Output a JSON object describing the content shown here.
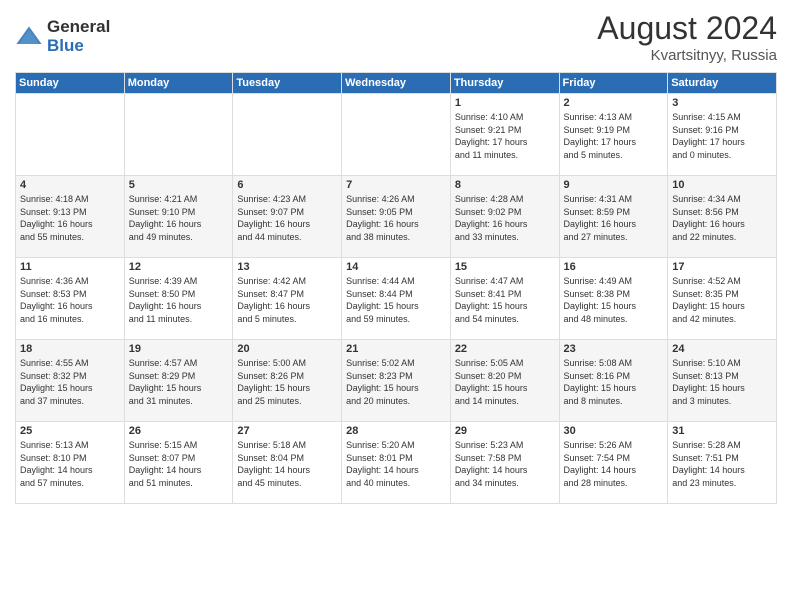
{
  "logo": {
    "general": "General",
    "blue": "Blue"
  },
  "title": {
    "month_year": "August 2024",
    "location": "Kvartsitnyy, Russia"
  },
  "days_of_week": [
    "Sunday",
    "Monday",
    "Tuesday",
    "Wednesday",
    "Thursday",
    "Friday",
    "Saturday"
  ],
  "weeks": [
    [
      {
        "day": "",
        "content": ""
      },
      {
        "day": "",
        "content": ""
      },
      {
        "day": "",
        "content": ""
      },
      {
        "day": "",
        "content": ""
      },
      {
        "day": "1",
        "content": "Sunrise: 4:10 AM\nSunset: 9:21 PM\nDaylight: 17 hours\nand 11 minutes."
      },
      {
        "day": "2",
        "content": "Sunrise: 4:13 AM\nSunset: 9:19 PM\nDaylight: 17 hours\nand 5 minutes."
      },
      {
        "day": "3",
        "content": "Sunrise: 4:15 AM\nSunset: 9:16 PM\nDaylight: 17 hours\nand 0 minutes."
      }
    ],
    [
      {
        "day": "4",
        "content": "Sunrise: 4:18 AM\nSunset: 9:13 PM\nDaylight: 16 hours\nand 55 minutes."
      },
      {
        "day": "5",
        "content": "Sunrise: 4:21 AM\nSunset: 9:10 PM\nDaylight: 16 hours\nand 49 minutes."
      },
      {
        "day": "6",
        "content": "Sunrise: 4:23 AM\nSunset: 9:07 PM\nDaylight: 16 hours\nand 44 minutes."
      },
      {
        "day": "7",
        "content": "Sunrise: 4:26 AM\nSunset: 9:05 PM\nDaylight: 16 hours\nand 38 minutes."
      },
      {
        "day": "8",
        "content": "Sunrise: 4:28 AM\nSunset: 9:02 PM\nDaylight: 16 hours\nand 33 minutes."
      },
      {
        "day": "9",
        "content": "Sunrise: 4:31 AM\nSunset: 8:59 PM\nDaylight: 16 hours\nand 27 minutes."
      },
      {
        "day": "10",
        "content": "Sunrise: 4:34 AM\nSunset: 8:56 PM\nDaylight: 16 hours\nand 22 minutes."
      }
    ],
    [
      {
        "day": "11",
        "content": "Sunrise: 4:36 AM\nSunset: 8:53 PM\nDaylight: 16 hours\nand 16 minutes."
      },
      {
        "day": "12",
        "content": "Sunrise: 4:39 AM\nSunset: 8:50 PM\nDaylight: 16 hours\nand 11 minutes."
      },
      {
        "day": "13",
        "content": "Sunrise: 4:42 AM\nSunset: 8:47 PM\nDaylight: 16 hours\nand 5 minutes."
      },
      {
        "day": "14",
        "content": "Sunrise: 4:44 AM\nSunset: 8:44 PM\nDaylight: 15 hours\nand 59 minutes."
      },
      {
        "day": "15",
        "content": "Sunrise: 4:47 AM\nSunset: 8:41 PM\nDaylight: 15 hours\nand 54 minutes."
      },
      {
        "day": "16",
        "content": "Sunrise: 4:49 AM\nSunset: 8:38 PM\nDaylight: 15 hours\nand 48 minutes."
      },
      {
        "day": "17",
        "content": "Sunrise: 4:52 AM\nSunset: 8:35 PM\nDaylight: 15 hours\nand 42 minutes."
      }
    ],
    [
      {
        "day": "18",
        "content": "Sunrise: 4:55 AM\nSunset: 8:32 PM\nDaylight: 15 hours\nand 37 minutes."
      },
      {
        "day": "19",
        "content": "Sunrise: 4:57 AM\nSunset: 8:29 PM\nDaylight: 15 hours\nand 31 minutes."
      },
      {
        "day": "20",
        "content": "Sunrise: 5:00 AM\nSunset: 8:26 PM\nDaylight: 15 hours\nand 25 minutes."
      },
      {
        "day": "21",
        "content": "Sunrise: 5:02 AM\nSunset: 8:23 PM\nDaylight: 15 hours\nand 20 minutes."
      },
      {
        "day": "22",
        "content": "Sunrise: 5:05 AM\nSunset: 8:20 PM\nDaylight: 15 hours\nand 14 minutes."
      },
      {
        "day": "23",
        "content": "Sunrise: 5:08 AM\nSunset: 8:16 PM\nDaylight: 15 hours\nand 8 minutes."
      },
      {
        "day": "24",
        "content": "Sunrise: 5:10 AM\nSunset: 8:13 PM\nDaylight: 15 hours\nand 3 minutes."
      }
    ],
    [
      {
        "day": "25",
        "content": "Sunrise: 5:13 AM\nSunset: 8:10 PM\nDaylight: 14 hours\nand 57 minutes."
      },
      {
        "day": "26",
        "content": "Sunrise: 5:15 AM\nSunset: 8:07 PM\nDaylight: 14 hours\nand 51 minutes."
      },
      {
        "day": "27",
        "content": "Sunrise: 5:18 AM\nSunset: 8:04 PM\nDaylight: 14 hours\nand 45 minutes."
      },
      {
        "day": "28",
        "content": "Sunrise: 5:20 AM\nSunset: 8:01 PM\nDaylight: 14 hours\nand 40 minutes."
      },
      {
        "day": "29",
        "content": "Sunrise: 5:23 AM\nSunset: 7:58 PM\nDaylight: 14 hours\nand 34 minutes."
      },
      {
        "day": "30",
        "content": "Sunrise: 5:26 AM\nSunset: 7:54 PM\nDaylight: 14 hours\nand 28 minutes."
      },
      {
        "day": "31",
        "content": "Sunrise: 5:28 AM\nSunset: 7:51 PM\nDaylight: 14 hours\nand 23 minutes."
      }
    ]
  ]
}
